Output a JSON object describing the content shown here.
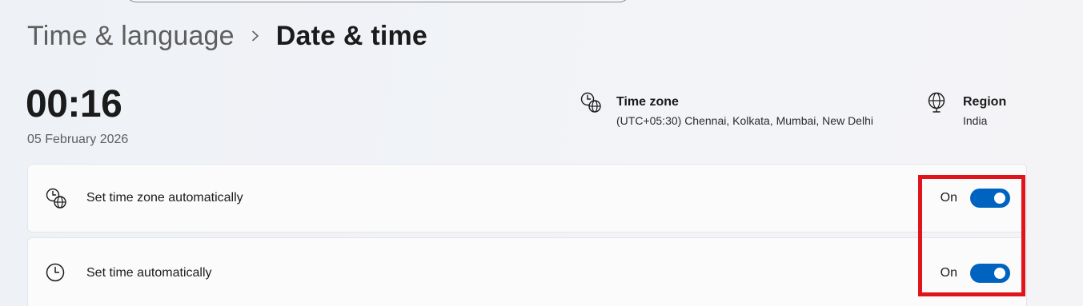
{
  "breadcrumb": {
    "parent": "Time & language",
    "separator": "›",
    "current": "Date & time"
  },
  "clock": {
    "time": "00:16",
    "date": "05 February 2026"
  },
  "time_zone": {
    "title": "Time zone",
    "value": "(UTC+05:30) Chennai, Kolkata, Mumbai, New Delhi",
    "icon": "clock-globe-icon"
  },
  "region": {
    "title": "Region",
    "value": "India",
    "icon": "globe-icon"
  },
  "settings": [
    {
      "label": "Set time zone automatically",
      "state_label": "On",
      "enabled": true,
      "icon": "clock-globe-icon"
    },
    {
      "label": "Set time automatically",
      "state_label": "On",
      "enabled": true,
      "icon": "clock-icon"
    }
  ],
  "colors": {
    "accent": "#0063bf",
    "highlight": "#e0141b"
  }
}
